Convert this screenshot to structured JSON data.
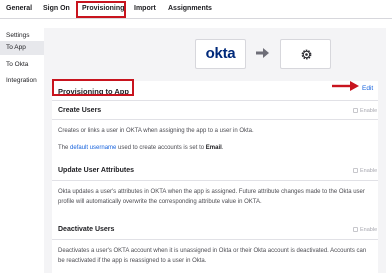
{
  "tabs": [
    {
      "label": "General"
    },
    {
      "label": "Sign On"
    },
    {
      "label": "Provisioning"
    },
    {
      "label": "Import"
    },
    {
      "label": "Assignments"
    }
  ],
  "leftnav": {
    "heading": "Settings",
    "items": [
      {
        "label": "To App",
        "active": true
      },
      {
        "label": "To Okta"
      },
      {
        "label": "Integration"
      }
    ]
  },
  "logos": {
    "source": "okta",
    "arrow_icon": "arrow-right-icon",
    "target_icon": "gear-icon"
  },
  "provisioning": {
    "title": "Provisioning to App",
    "edit_label": "Edit",
    "sections": [
      {
        "title": "Create Users",
        "enable_label": "Enable",
        "desc": "Creates or links a user in OKTA when assigning the app to a user in Okta.",
        "desc2_pre": "The ",
        "desc2_link": "default username",
        "desc2_mid": " used to create accounts is set to ",
        "desc2_bold": "Email",
        "desc2_post": "."
      },
      {
        "title": "Update User Attributes",
        "enable_label": "Enable",
        "desc": "Okta updates a user's attributes in OKTA when the app is assigned. Future attribute changes made to the Okta user profile will automatically overwrite the corresponding attribute value in OKTA."
      },
      {
        "title": "Deactivate Users",
        "enable_label": "Enable",
        "desc": "Deactivates a user's OKTA account when it is unassigned in Okta or their Okta account is deactivated. Accounts can be reactivated if the app is reassigned to a user in Okta."
      }
    ]
  },
  "colors": {
    "highlight": "#c8141e",
    "link": "#1662dd",
    "okta_brand": "#00297a"
  }
}
